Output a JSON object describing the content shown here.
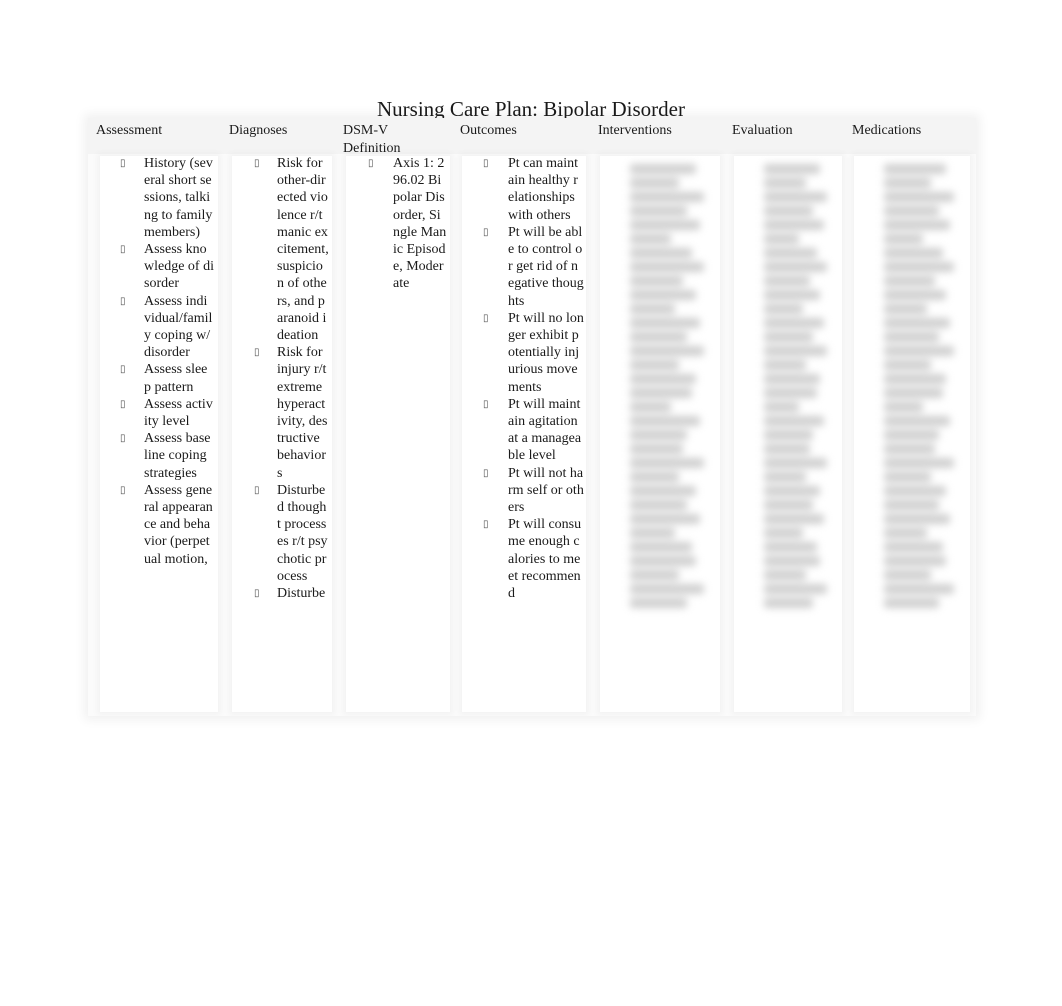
{
  "document": {
    "title": "Nursing Care Plan: Bipolar Disorder",
    "bullet_icon": "▯",
    "columns": [
      {
        "header": "Assessment",
        "items": [
          "History (several short sessions, talking to family members)",
          "Assess knowledge of disorder",
          "Assess individual/family coping w/ disorder",
          "Assess sleep pattern",
          "Assess activity level",
          "Assess baseline coping strategies",
          "Assess general appearance and behavior (perpetual motion,"
        ]
      },
      {
        "header": "Diagnoses",
        "items": [
          "Risk for other-directed violence r/t manic excitement, suspicion of others, and paranoid ideation",
          "Risk for injury r/t extreme hyperactivity, destructive behaviors",
          "Disturbed thought processes r/t psychotic process",
          "Disturbe"
        ]
      },
      {
        "header": "DSM-V Definition",
        "items": [
          "Axis 1: 296.02 Bipolar Disorder, Single Manic Episode, Moderate"
        ]
      },
      {
        "header": "Outcomes",
        "items": [
          "Pt can maintain healthy relationships with others",
          "Pt will be able to control or get rid of negative thoughts",
          "Pt will no longer exhibit potentially injurious movements",
          "Pt will maintain agitation at a manageable level",
          "Pt will not harm self or others",
          "Pt will consume enough calories to meet recommend"
        ]
      },
      {
        "header": "Interventions",
        "items": [],
        "blurred": true
      },
      {
        "header": "Evaluation",
        "items": [],
        "blurred": true
      },
      {
        "header": "Medications",
        "items": [],
        "blurred": true
      }
    ]
  }
}
